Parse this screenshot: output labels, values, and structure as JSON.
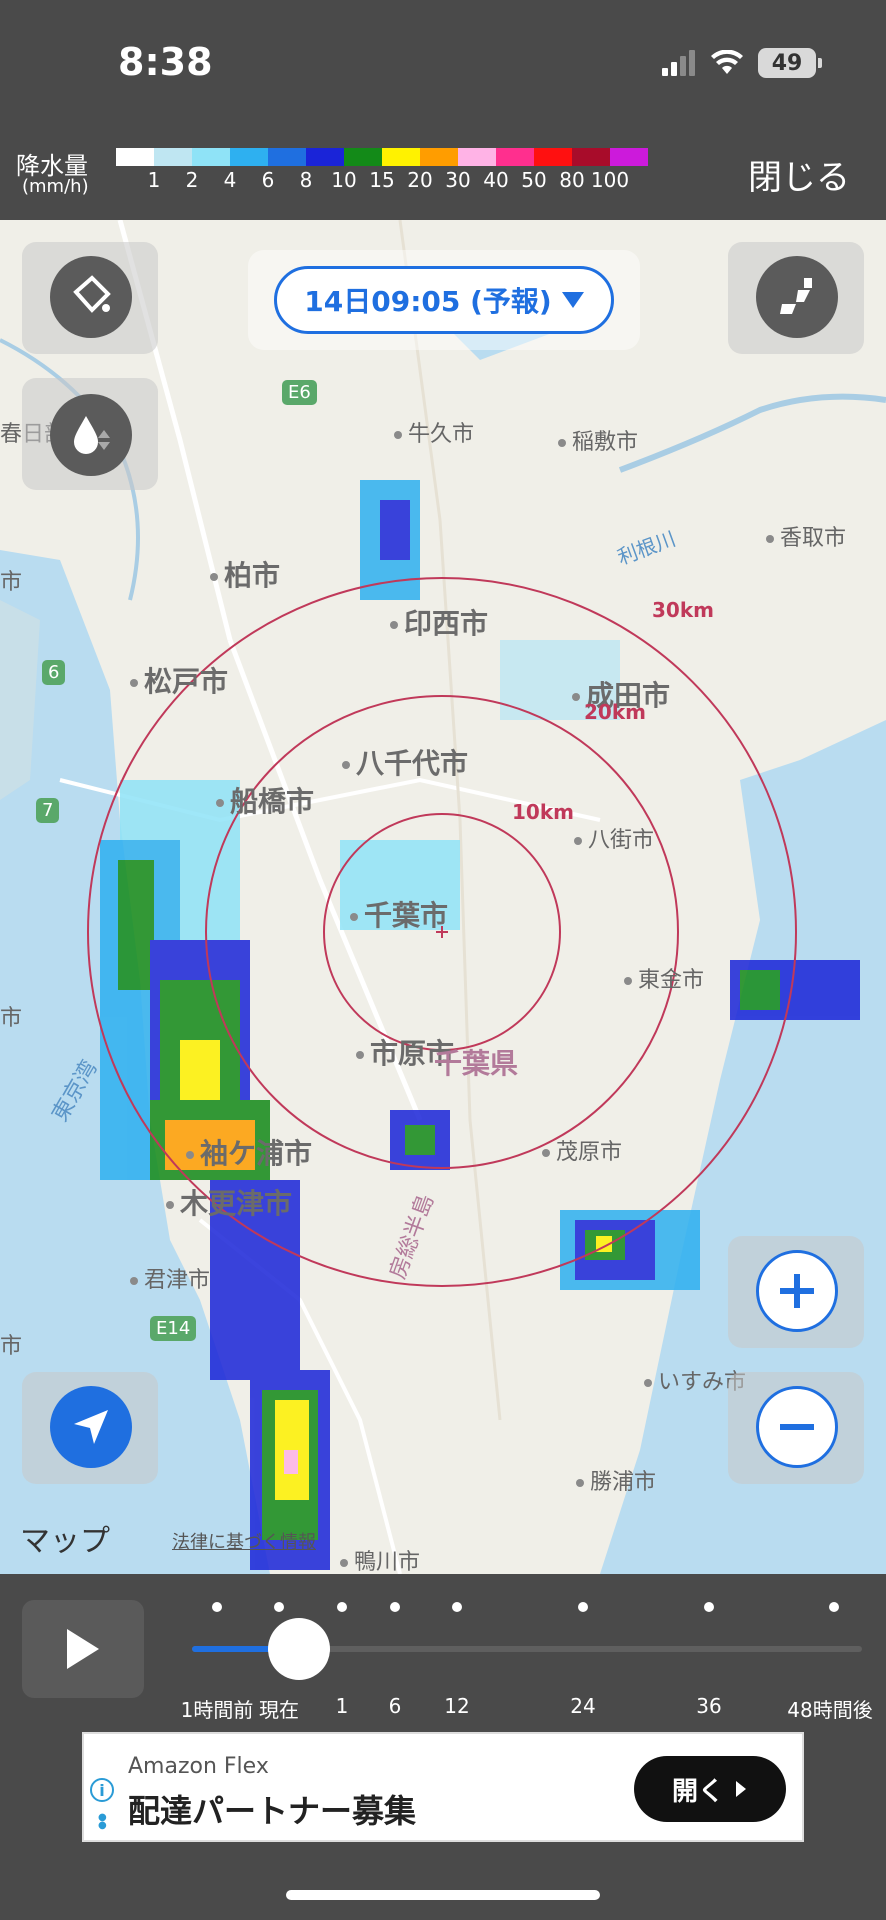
{
  "status": {
    "time": "8:38",
    "battery": "49"
  },
  "legend": {
    "title": "降水量",
    "unit": "(mm/h)",
    "colors": [
      "#ffffff",
      "#bfe6f2",
      "#8fe3f7",
      "#2eb0f0",
      "#1f6fe0",
      "#1a24d8",
      "#138a18",
      "#fff200",
      "#ff9d00",
      "#ffb3e6",
      "#ff2f8e",
      "#ff1010",
      "#a80c2a",
      "#cc1adb"
    ],
    "ticks": [
      "1",
      "2",
      "4",
      "6",
      "8",
      "10",
      "15",
      "20",
      "30",
      "40",
      "50",
      "80",
      "100"
    ]
  },
  "close_label": "閉じる",
  "map": {
    "time_label": "14日09:05 (予報)",
    "places": {
      "ushiku": "牛久市",
      "inashiki": "稲敷市",
      "katori": "香取市",
      "kasukabe": "春日部市",
      "kashiwa": "柏市",
      "inzai": "印西市",
      "narita": "成田市",
      "matsudo": "松戸市",
      "yachiyo": "八千代市",
      "funabashi": "船橋市",
      "yachimata": "八街市",
      "chiba": "千葉市",
      "togane": "東金市",
      "ichihara": "市原市",
      "pref": "千葉県",
      "mobara": "茂原市",
      "sodegaura": "袖ケ浦市",
      "kisarazu": "木更津市",
      "kimitsu": "君津市",
      "isumi": "いすみ市",
      "katsuura": "勝浦市",
      "kamogawa": "鴨川市",
      "tonegawa": "利根川",
      "tokyowan": "東京湾",
      "boso": "房総半島",
      "left_shi_1": "市",
      "left_shi_2": "市",
      "left_shi_3": "市"
    },
    "rings": [
      "10km",
      "20km",
      "30km"
    ],
    "routes": [
      "E6",
      "6",
      "7",
      "E14"
    ],
    "credits": "マップ",
    "legal": "法律に基づく情報"
  },
  "timeline": {
    "labels": [
      "1時間前",
      "現在",
      "1",
      "6",
      "12",
      "24",
      "36",
      "48時間後"
    ],
    "position": 0.16
  },
  "ad": {
    "sponsor": "Amazon Flex",
    "title": "配達パートナー募集",
    "button": "開く"
  }
}
